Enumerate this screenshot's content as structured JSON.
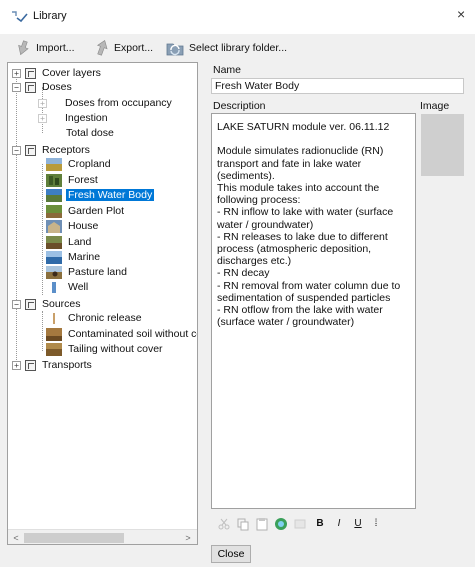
{
  "window": {
    "title": "Library",
    "close_glyph": "×"
  },
  "toolbar": {
    "import_label": "Import...",
    "export_label": "Export...",
    "select_folder_label": "Select library folder..."
  },
  "tree": {
    "cover_layers": "Cover layers",
    "doses": "Doses",
    "doses_from_occupancy": "Doses from occupancy",
    "ingestion": "Ingestion",
    "total_dose": "Total dose",
    "receptors": "Receptors",
    "cropland": "Cropland",
    "forest": "Forest",
    "fresh_water_body": "Fresh Water Body",
    "garden_plot": "Garden Plot",
    "house": "House",
    "land": "Land",
    "marine": "Marine",
    "pasture_land": "Pasture land",
    "well": "Well",
    "sources": "Sources",
    "chronic_release": "Chronic release",
    "contaminated_soil": "Contaminated soil without co",
    "tailing": "Tailing without cover",
    "transports": "Transports",
    "expand_glyph": "+",
    "collapse_glyph": "−"
  },
  "scrollbar": {
    "left_arrow": "<",
    "right_arrow": ">"
  },
  "details": {
    "name_label": "Name",
    "name_value": "Fresh Water Body",
    "description_label": "Description",
    "image_label": "Image",
    "description_text": "LAKE SATURN module ver. 06.11.12\n\nModule simulates radionuclide (RN)\ntransport and fate in lake water\n(sediments).\nThis module takes into account the\nfollowing process:\n- RN inflow to lake with water (surface\nwater / groundwater)\n- RN releases to lake due to different\nprocess (atmospheric deposition,\ndischarges etc.)\n- RN decay\n- RN removal from water column due to\nsedimentation of suspended particles\n- RN otflow from the lake with water\n(surface water / groundwater)"
  },
  "format_bar": {
    "bold": "B",
    "italic": "I",
    "underline": "U",
    "more": "⁞"
  },
  "footer": {
    "close_label": "Close"
  }
}
